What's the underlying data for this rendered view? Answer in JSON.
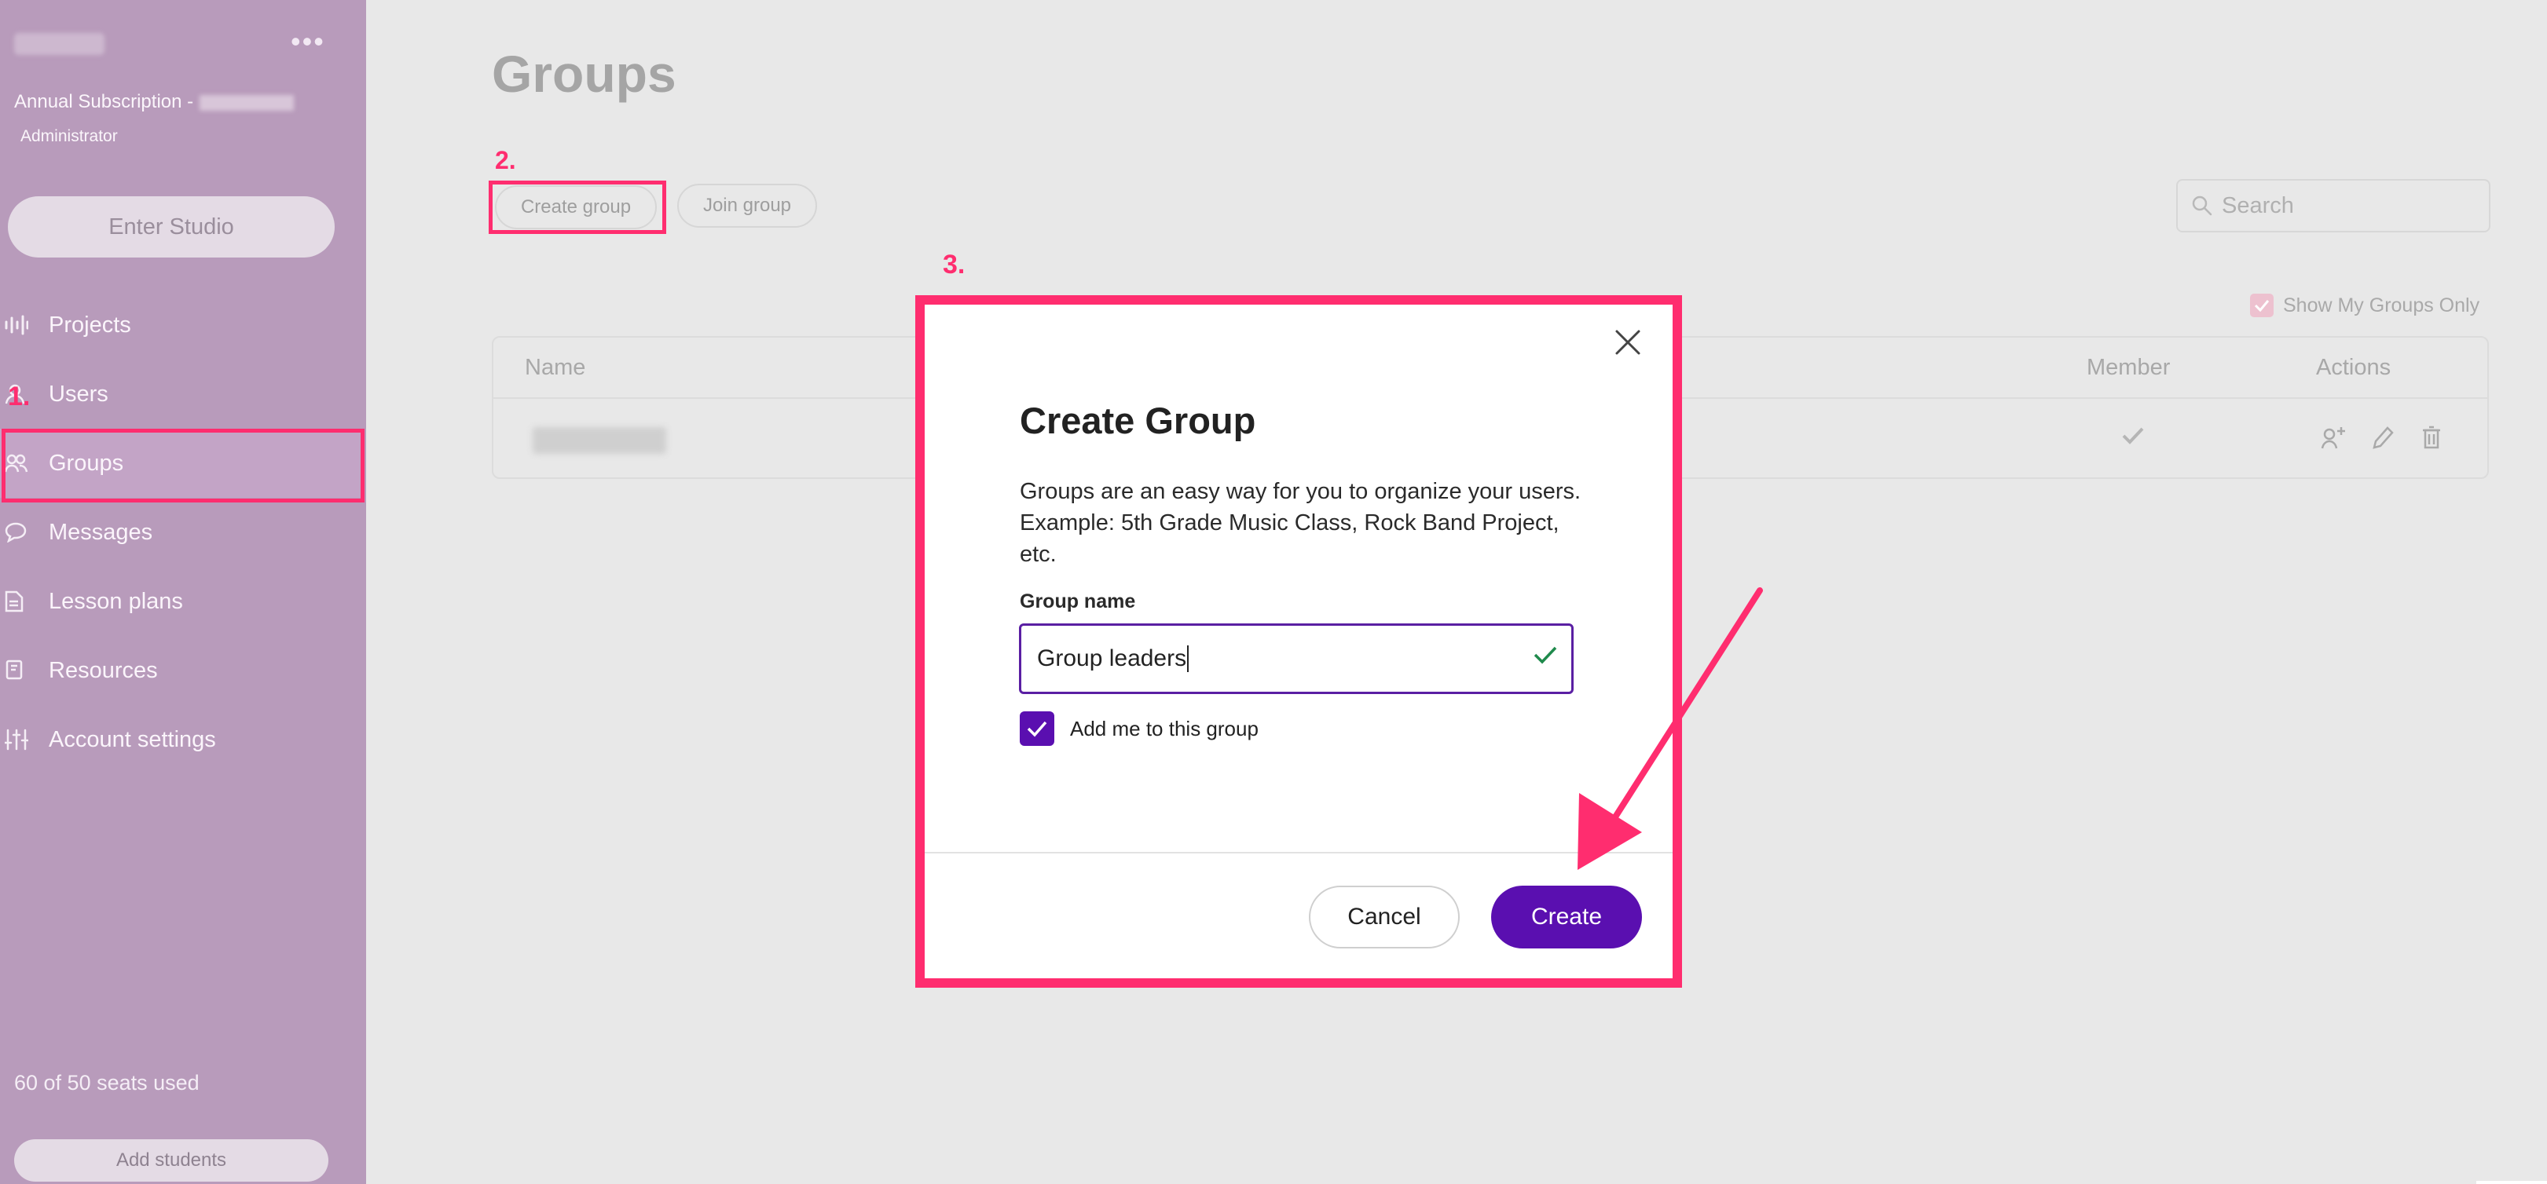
{
  "sidebar": {
    "more_label": "•••",
    "subscription": "Annual Subscription -",
    "role": "Administrator",
    "enter_studio": "Enter Studio",
    "items": [
      {
        "label": "Projects"
      },
      {
        "label": "Users"
      },
      {
        "label": "Groups"
      },
      {
        "label": "Messages"
      },
      {
        "label": "Lesson plans"
      },
      {
        "label": "Resources"
      },
      {
        "label": "Account settings"
      }
    ],
    "seats": "60 of 50 seats used",
    "add_students": "Add students"
  },
  "annotations": {
    "step1": "1.",
    "step2": "2.",
    "step3": "3."
  },
  "main": {
    "title": "Groups",
    "create_group": "Create group",
    "join_group": "Join group",
    "search_placeholder": "Search",
    "show_mine": "Show My Groups Only",
    "table": {
      "col_name": "Name",
      "col_member": "Member",
      "col_actions": "Actions"
    }
  },
  "modal": {
    "title": "Create Group",
    "description": "Groups are an easy way for you to organize your users. Example: 5th Grade Music Class, Rock Band Project, etc.",
    "field_label": "Group name",
    "field_value": "Group leaders",
    "add_me_label": "Add me to this group",
    "add_me_checked": true,
    "cancel": "Cancel",
    "create": "Create"
  },
  "colors": {
    "accent": "#5a0fb0",
    "annotation": "#ff2d6f",
    "sidebar": "#b89bbb"
  }
}
